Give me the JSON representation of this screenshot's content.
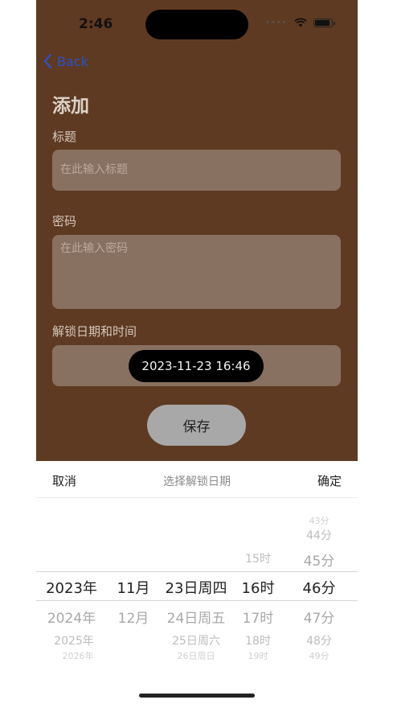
{
  "status_bar": {
    "time": "2:46"
  },
  "nav": {
    "back_label": "Back"
  },
  "form": {
    "heading": "添加",
    "title_label": "标题",
    "title_placeholder": "在此输入标题",
    "password_label": "密码",
    "password_placeholder": "在此输入密码",
    "unlock_label": "解锁日期和时间",
    "unlock_value": "2023-11-23 16:46",
    "save_label": "保存"
  },
  "picker": {
    "cancel_label": "取消",
    "title": "选择解锁日期",
    "confirm_label": "确定",
    "columns": [
      {
        "name": "year",
        "items": [
          "2023年",
          "2024年",
          "2025年",
          "2026年"
        ],
        "selected": "2023年"
      },
      {
        "name": "month",
        "items": [
          "11月",
          "12月"
        ],
        "selected": "11月"
      },
      {
        "name": "day",
        "items": [
          "23日周四",
          "24日周五",
          "25日周六",
          "26日周日"
        ],
        "selected": "23日周四"
      },
      {
        "name": "hour",
        "items": [
          "15时",
          "16时",
          "17时",
          "18时",
          "19时"
        ],
        "selected": "16时"
      },
      {
        "name": "minute",
        "items": [
          "43分",
          "44分",
          "45分",
          "46分",
          "47分",
          "48分",
          "49分"
        ],
        "selected": "46分"
      }
    ]
  },
  "colors": {
    "background": "#5e3a22",
    "field": "#887161",
    "accent": "#2a52c9"
  }
}
